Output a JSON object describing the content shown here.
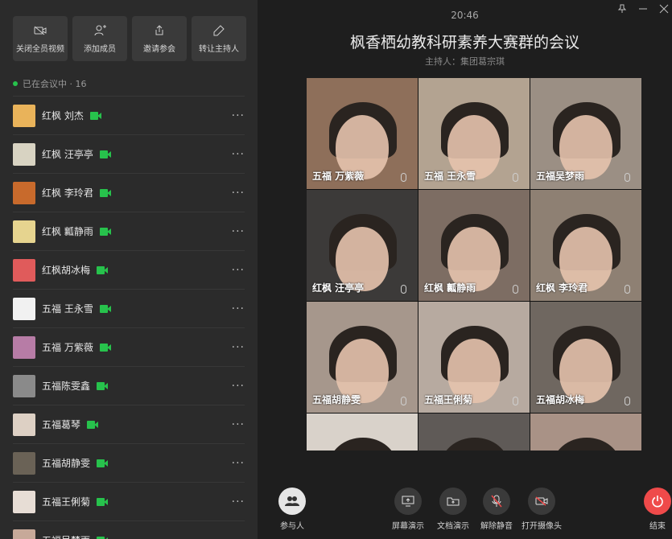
{
  "sidebar": {
    "actions": [
      {
        "label": "关闭全员视频",
        "icon": "video-off-icon"
      },
      {
        "label": "添加成员",
        "icon": "add-user-icon"
      },
      {
        "label": "邀请参会",
        "icon": "share-icon"
      },
      {
        "label": "转让主持人",
        "icon": "pen-icon"
      }
    ],
    "status_label": "已在会议中 · 16",
    "members": [
      {
        "name": "红枫   刘杰",
        "avatar_color": "#e9b35a"
      },
      {
        "name": "红枫   汪亭亭",
        "avatar_color": "#d8d3c2"
      },
      {
        "name": "红枫 李玲君",
        "avatar_color": "#c86a2c"
      },
      {
        "name": "红枫 瓤静雨",
        "avatar_color": "#e6d48f"
      },
      {
        "name": "红枫胡冰梅",
        "avatar_color": "#e05b5b"
      },
      {
        "name": "五福 王永雪",
        "avatar_color": "#f1f1f1"
      },
      {
        "name": "五福 万紫薇",
        "avatar_color": "#b77ca6"
      },
      {
        "name": "五福陈雯鑫",
        "avatar_color": "#8a8a8a"
      },
      {
        "name": "五福葛琴",
        "avatar_color": "#ddd0c4"
      },
      {
        "name": "五福胡静雯",
        "avatar_color": "#6a6256"
      },
      {
        "name": "五福王俐菊",
        "avatar_color": "#e7ddd5"
      },
      {
        "name": "五福吴梦雨",
        "avatar_color": "#c7a999"
      }
    ]
  },
  "main": {
    "time": "20:46",
    "title": "枫香栖幼教科研素养大赛群的会议",
    "host": "主持人：集团葛宗琪",
    "tiles": [
      {
        "name": "五福 万紫薇",
        "bg": "#8e6f5a"
      },
      {
        "name": "五福 王永雪",
        "bg": "#b3a391"
      },
      {
        "name": "五福吴梦雨",
        "bg": "#9b8f84"
      },
      {
        "name": "红枫   汪亭亭",
        "bg": "#3c3a39"
      },
      {
        "name": "红枫 瓤静雨",
        "bg": "#7d6d63"
      },
      {
        "name": "红枫 李玲君",
        "bg": "#8e8073"
      },
      {
        "name": "五福胡静雯",
        "bg": "#a6978c"
      },
      {
        "name": "五福王俐菊",
        "bg": "#b7aaa0"
      },
      {
        "name": "五福胡冰梅",
        "bg": "#6f6760"
      },
      {
        "name": "",
        "bg": "#d9d2ca"
      },
      {
        "name": "",
        "bg": "#5f5a57"
      },
      {
        "name": "",
        "bg": "#a99286"
      }
    ]
  },
  "toolbar": {
    "participants": "参与人",
    "screen_share": "屏幕演示",
    "doc_share": "文档演示",
    "unmute": "解除静音",
    "camera_on": "打开摄像头",
    "end": "结束"
  }
}
